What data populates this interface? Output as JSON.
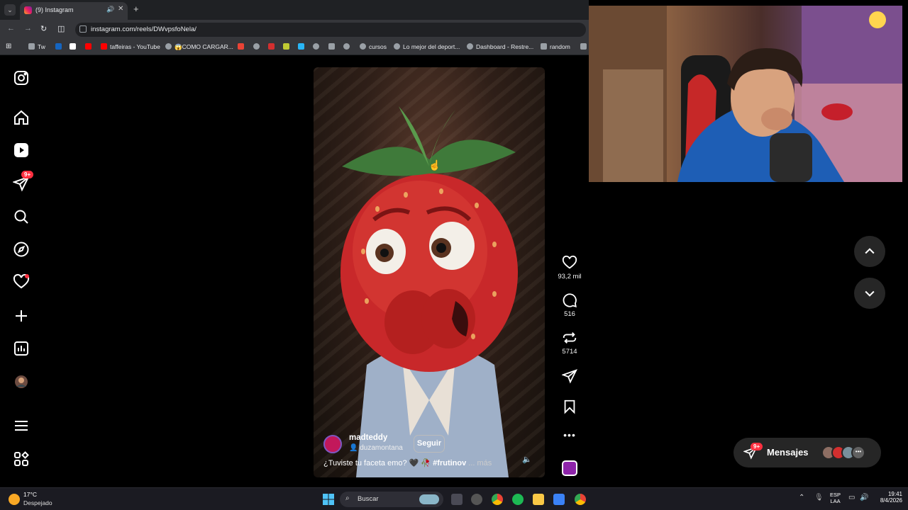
{
  "browser": {
    "tab_title": "(9) Instagram",
    "url": "instagram.com/reels/DWvpsfoNela/",
    "bookmarks": [
      {
        "label": "Tw",
        "color": "#9aa0a6",
        "icon": "folder-icon"
      },
      {
        "label": "",
        "color": "#1565c0",
        "icon": "bookmark-icon"
      },
      {
        "label": "",
        "color": "#ffffff",
        "icon": "tiktok-icon"
      },
      {
        "label": "",
        "color": "#ff0000",
        "icon": "youtube-icon"
      },
      {
        "label": "taffeiras - YouTube",
        "color": "#ff0000",
        "icon": "youtube-icon"
      },
      {
        "label": "😱COMO CARGAR...",
        "color": "#9aa0a6",
        "icon": "globe-icon"
      },
      {
        "label": "",
        "color": "#ea4335",
        "icon": "gmail-icon"
      },
      {
        "label": "",
        "color": "#9aa0a6",
        "icon": "globe-icon"
      },
      {
        "label": "",
        "color": "#d32f2f",
        "icon": "bookmark-icon"
      },
      {
        "label": "",
        "color": "#c0ca33",
        "icon": "bookmark-icon"
      },
      {
        "label": "",
        "color": "#29b6f6",
        "icon": "bookmark-icon"
      },
      {
        "label": "",
        "color": "#9aa0a6",
        "icon": "globe-icon"
      },
      {
        "label": "",
        "color": "#9aa0a6",
        "icon": "bookmark-icon"
      },
      {
        "label": "",
        "color": "#9aa0a6",
        "icon": "globe-icon"
      },
      {
        "label": "cursos",
        "color": "#9aa0a6",
        "icon": "globe-icon"
      },
      {
        "label": "Lo mejor del deport...",
        "color": "#9aa0a6",
        "icon": "globe-icon"
      },
      {
        "label": "Dashboard - Restre...",
        "color": "#9aa0a6",
        "icon": "globe-icon"
      },
      {
        "label": "random",
        "color": "#9aa0a6",
        "icon": "folder-icon"
      },
      {
        "label": "",
        "color": "#9aa0a6",
        "icon": "folder-icon"
      }
    ]
  },
  "sidebar": {
    "notifications_badge": "9+",
    "items": [
      {
        "name": "instagram-logo-icon"
      },
      {
        "name": "home-icon"
      },
      {
        "name": "reels-icon"
      },
      {
        "name": "messages-icon"
      },
      {
        "name": "search-icon"
      },
      {
        "name": "explore-icon"
      },
      {
        "name": "notifications-icon"
      },
      {
        "name": "create-icon"
      },
      {
        "name": "dashboard-icon"
      },
      {
        "name": "profile-avatar"
      },
      {
        "name": "more-menu-icon"
      },
      {
        "name": "also-from-meta-icon"
      }
    ]
  },
  "reel": {
    "username": "madteddy",
    "collab_username": "duzamontana",
    "follow_label": "Seguir",
    "caption": "¿Tuviste tu faceta emo? 🖤 🥀",
    "hashtag": "#frutinov",
    "more_label": "... más",
    "likes": "93,2 mil",
    "comments": "516",
    "reposts": "5714"
  },
  "messages": {
    "label": "Mensajes",
    "badge": "9+"
  },
  "taskbar": {
    "weather_temp": "17°C",
    "weather_desc": "Despejado",
    "search_placeholder": "Buscar",
    "lang_top": "ESP",
    "lang_bottom": "LAA",
    "time": "19:41",
    "date": "8/4/2026"
  },
  "colors": {
    "instagram_red": "#ff3040",
    "page_bg": "#000000",
    "panel": "#262626"
  }
}
